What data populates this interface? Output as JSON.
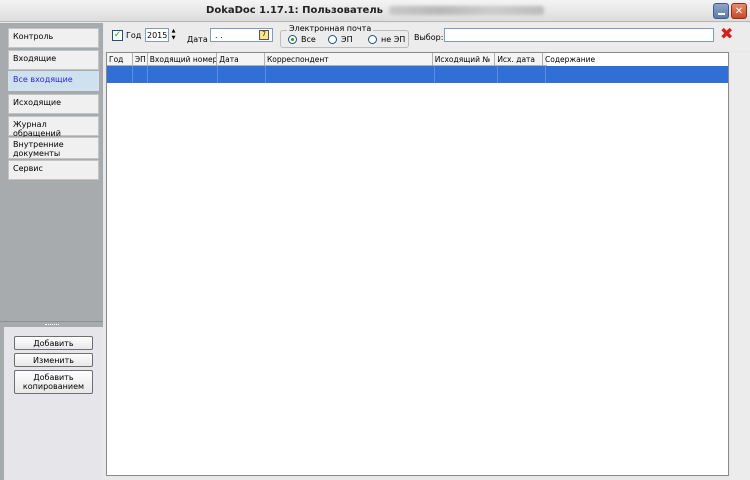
{
  "window": {
    "title": "DokaDoc 1.17.1: Пользователь"
  },
  "nav": {
    "items": [
      {
        "label": "Контроль"
      },
      {
        "label": "Входящие"
      },
      {
        "label": "Все входящие"
      },
      {
        "label": "Исходящие"
      },
      {
        "label": "Журнал обращений"
      },
      {
        "label": "Внутренние документы"
      },
      {
        "label": "Сервис"
      }
    ]
  },
  "actions": {
    "add": "Добавить",
    "edit": "Изменить",
    "add_copy": "Добавить копированием"
  },
  "filters": {
    "year_checked": true,
    "year_label": "Год",
    "year_value": "2015",
    "date_label": "Дата",
    "date_value": " .  .",
    "email_group": "Электронная почта",
    "email_options": [
      "Все",
      "ЭП",
      "не ЭП"
    ],
    "email_selected": "Все",
    "selection_label": "Выбор:",
    "selection_value": ""
  },
  "grid": {
    "columns": [
      "Год",
      "ЭП",
      "Входящий номер",
      "Дата",
      "Корреспондент",
      "Исходящий №",
      "Исх. дата",
      "Содержание"
    ],
    "selected_row_index": 0
  },
  "colors": {
    "selected_row": "#2f6fd6",
    "sub_item_text": "#2a2ad0",
    "clear_icon": "#d81f1f",
    "left_panel": "#a7abae"
  }
}
